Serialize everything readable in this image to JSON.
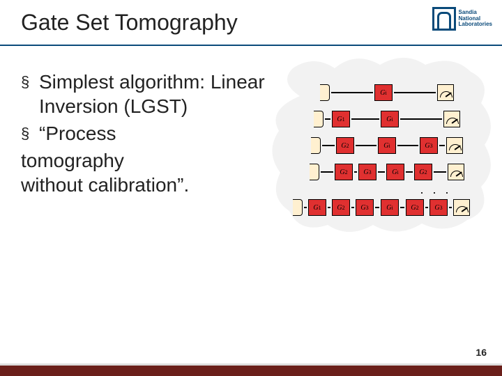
{
  "title": "Gate Set Tomography",
  "logo": {
    "line1": "Sandia",
    "line2": "National",
    "line3": "Laboratories"
  },
  "bullets": [
    {
      "marker": "§",
      "text": "Simplest algorithm: Linear Inversion (LGST)"
    },
    {
      "marker": "§",
      "text": "“Process"
    }
  ],
  "continuation": [
    "tomography",
    "without calibration”."
  ],
  "gates": {
    "gi": "G",
    "gi_sub": "i",
    "g1": "G",
    "g1_sub": "1",
    "g2": "G",
    "g2_sub": "2",
    "g3": "G",
    "g3_sub": "3"
  },
  "ellipsis": ". . .",
  "page_number": "16"
}
